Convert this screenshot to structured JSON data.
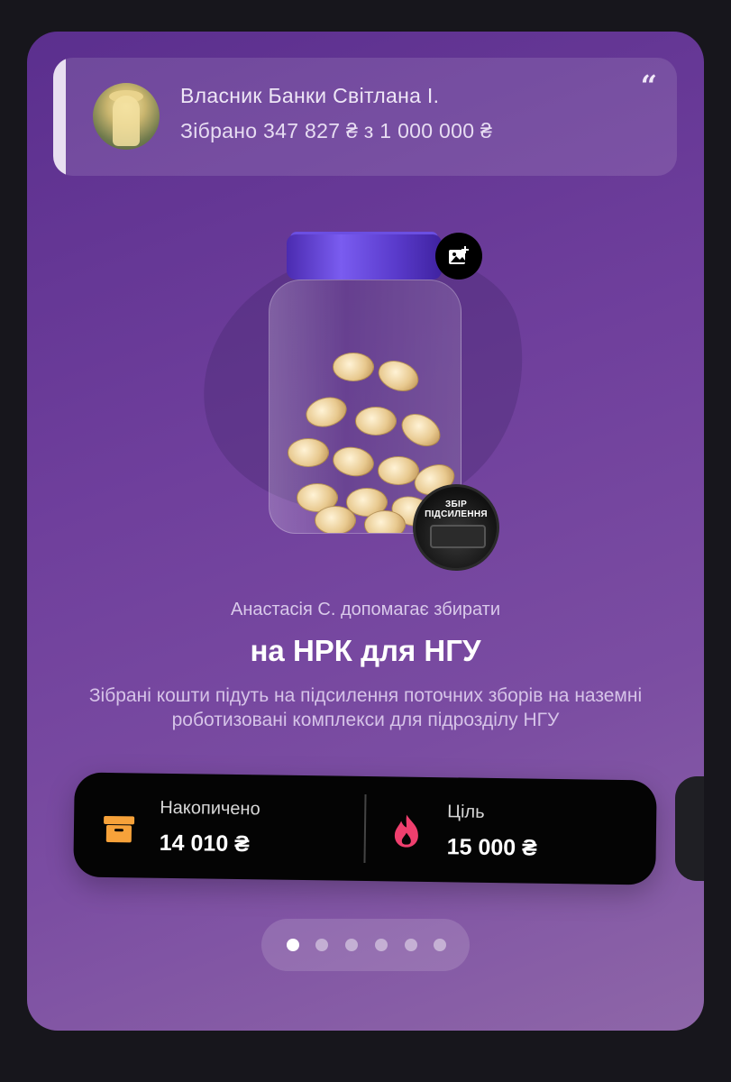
{
  "owner": {
    "name": "Власник Банки Світлана І.",
    "collected": "Зібрано 347 827 ₴ з 1 000 000 ₴",
    "quote_icon": "quote-icon",
    "avatar_icon": "avatar"
  },
  "jar": {
    "add_image_icon": "add-image-icon",
    "badge_text": "ЗБІР ПІДСИЛЕННЯ"
  },
  "helper_text": "Анастасія С. допомагає збирати",
  "title": "на НРК для НГУ",
  "description": "Зібрані кошти підуть на підсилення поточних зборів на наземні роботизовані комплекси для підрозділу НГУ",
  "stats": {
    "accumulated_label": "Накопичено",
    "accumulated_value": "14 010 ₴",
    "goal_label": "Ціль",
    "goal_value": "15 000 ₴",
    "accumulated_icon": "box-icon",
    "goal_icon": "flame-icon",
    "colors": {
      "box": "#f7a23a",
      "flame": "#ef3f6e",
      "chart": "#2cb058"
    }
  },
  "pagination": {
    "count": 6,
    "active": 0
  }
}
